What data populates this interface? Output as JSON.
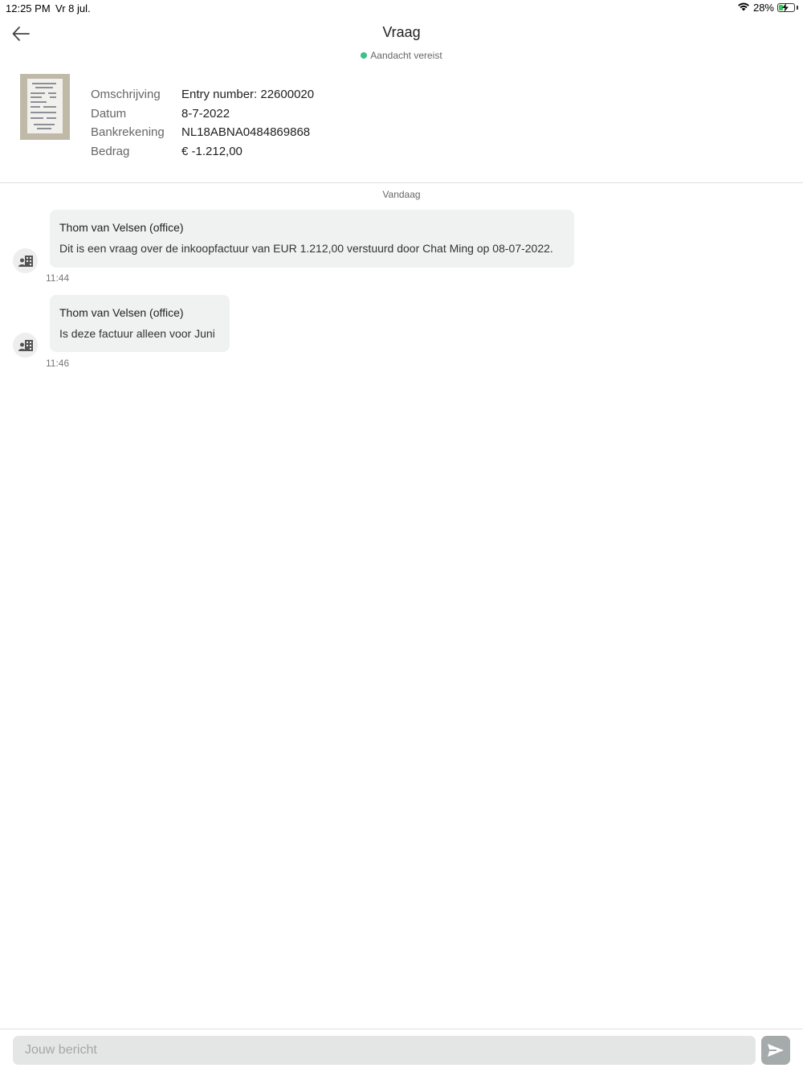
{
  "status_bar": {
    "time": "12:25 PM",
    "date": "Vr 8 jul.",
    "battery": "28%",
    "battery_level": 0.28,
    "wifi_icon": "wifi-icon",
    "charging_icon": "bolt-icon"
  },
  "header": {
    "title": "Vraag",
    "status": "Aandacht vereist",
    "status_color": "#3fbf8a",
    "back_icon": "arrow-left-icon"
  },
  "details": {
    "thumbnail": "receipt-thumbnail",
    "rows": [
      {
        "label": "Omschrijving",
        "value": "Entry number: 22600020"
      },
      {
        "label": "Datum",
        "value": "8-7-2022"
      },
      {
        "label": "Bankrekening",
        "value": "NL18ABNA0484869868"
      },
      {
        "label": "Bedrag",
        "value": "€ -1.212,00"
      }
    ]
  },
  "chat": {
    "day_label": "Vandaag",
    "messages": [
      {
        "sender": "Thom van Velsen (office)",
        "text": "Dit is een vraag over de inkoopfactuur van EUR 1.212,00 verstuurd door  Chat Ming op 08-07-2022.",
        "time": "11:44",
        "avatar_icon": "office-contact-icon"
      },
      {
        "sender": "Thom van Velsen (office)",
        "text": "Is deze factuur alleen voor Juni",
        "time": "11:46",
        "avatar_icon": "office-contact-icon"
      }
    ]
  },
  "composer": {
    "placeholder": "Jouw bericht",
    "value": "",
    "send_icon": "send-icon"
  }
}
